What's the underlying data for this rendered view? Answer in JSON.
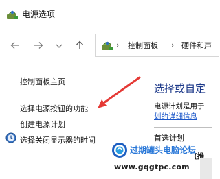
{
  "window": {
    "title": "电源选项"
  },
  "nav": {
    "back_icon": "arrow-left-icon",
    "forward_icon": "arrow-right-icon",
    "recent_icon": "chevron-down-icon",
    "up_icon": "arrow-up-icon"
  },
  "address": {
    "separator": "›",
    "crumbs": [
      "控制面板",
      "硬件和声"
    ]
  },
  "sidebar": {
    "items": [
      {
        "label": "控制面板主页"
      },
      {
        "label": "选择电源按钮的功能"
      },
      {
        "label": "创建电源计划"
      },
      {
        "label": "选择关闭显示器的时间",
        "icon": "monitor-clock-icon"
      }
    ]
  },
  "main": {
    "heading": "选择或自定",
    "description": "电源计划是用于",
    "link": "划的详细信息",
    "plans_heading": "首选计划",
    "partial_text": "(推"
  },
  "overlay": {
    "arrow_color": "#e53935",
    "watermark_line1": "过期罐头电脑论坛",
    "watermark_line2": "www.gqgtpc.com"
  },
  "colors": {
    "heading": "#1e3a8a",
    "link": "#1a56c8",
    "watermark_brand": "#2a78d8"
  }
}
